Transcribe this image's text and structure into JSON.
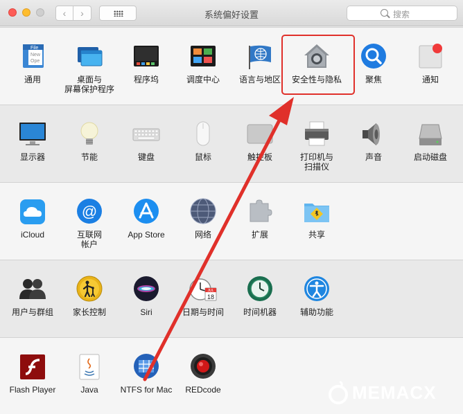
{
  "window": {
    "title": "系统偏好设置"
  },
  "toolbar": {
    "back_label": "‹",
    "forward_label": "›"
  },
  "search": {
    "placeholder": "搜索"
  },
  "panes": {
    "general": {
      "label": "通用"
    },
    "desktop": {
      "label": "桌面与\n屏幕保护程序"
    },
    "dock": {
      "label": "程序坞"
    },
    "mission": {
      "label": "调度中心"
    },
    "language": {
      "label": "语言与地区"
    },
    "security": {
      "label": "安全性与隐私"
    },
    "spotlight": {
      "label": "聚焦"
    },
    "notifications": {
      "label": "通知"
    },
    "displays": {
      "label": "显示器"
    },
    "energy": {
      "label": "节能"
    },
    "keyboard": {
      "label": "键盘"
    },
    "mouse": {
      "label": "鼠标"
    },
    "trackpad": {
      "label": "触控板"
    },
    "printers": {
      "label": "打印机与\n扫描仪"
    },
    "sound": {
      "label": "声音"
    },
    "startup": {
      "label": "启动磁盘"
    },
    "icloud": {
      "label": "iCloud"
    },
    "internet": {
      "label": "互联网\n帐户"
    },
    "appstore": {
      "label": "App Store"
    },
    "network": {
      "label": "网络"
    },
    "extensions": {
      "label": "扩展"
    },
    "sharing": {
      "label": "共享"
    },
    "users": {
      "label": "用户与群组"
    },
    "parental": {
      "label": "家长控制"
    },
    "siri": {
      "label": "Siri"
    },
    "datetime": {
      "label": "日期与时间"
    },
    "timemachine": {
      "label": "时间机器"
    },
    "accessibility": {
      "label": "辅助功能"
    },
    "flash": {
      "label": "Flash Player"
    },
    "java": {
      "label": "Java"
    },
    "ntfs": {
      "label": "NTFS for Mac"
    },
    "redcode": {
      "label": "REDcode"
    }
  },
  "icon_texts": {
    "general_file": "File",
    "general_new": "New",
    "general_open": "Ope",
    "calendar_month": "JUL",
    "calendar_day": "18"
  },
  "annotation": {
    "color": "#e0302a"
  },
  "watermark": {
    "text": "MEMACX"
  }
}
